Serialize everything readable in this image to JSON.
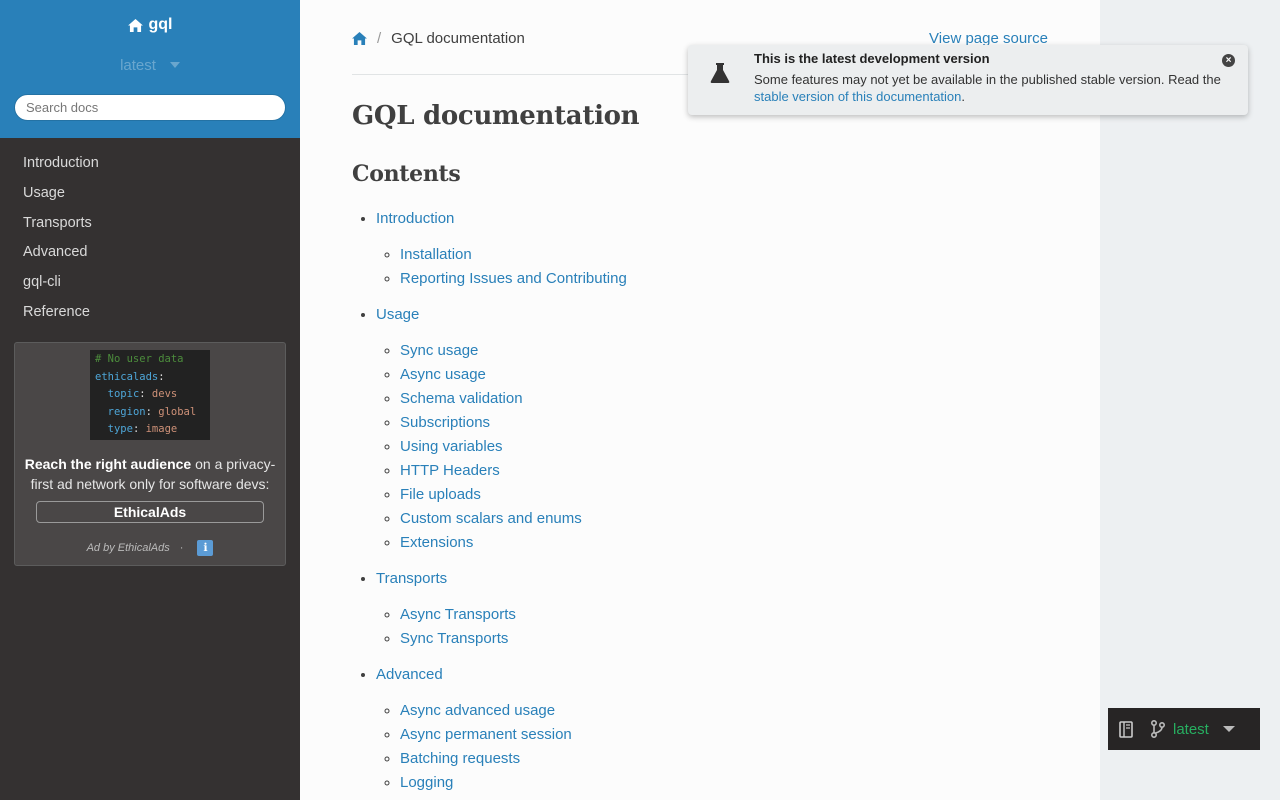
{
  "sidebar": {
    "project_name": "gql",
    "version": "latest",
    "search_placeholder": "Search docs",
    "nav": [
      {
        "label": "Introduction"
      },
      {
        "label": "Usage"
      },
      {
        "label": "Transports"
      },
      {
        "label": "Advanced"
      },
      {
        "label": "gql-cli"
      },
      {
        "label": "Reference"
      }
    ],
    "ad": {
      "code_lines": [
        "# No user data",
        "ethicalads",
        "topic",
        "devs",
        "region",
        "global",
        "type",
        "image"
      ],
      "headline": "Reach the right audience",
      "text": " on a privacy-first ad network only for software devs:",
      "button": "EthicalAds",
      "footer": "Ad by EthicalAds",
      "footer_sep": "·",
      "info_icon": "ℹ"
    }
  },
  "breadcrumb": {
    "home_icon": "home-icon",
    "separator": "/",
    "current": "GQL documentation",
    "view_source": "View page source"
  },
  "page": {
    "title": "GQL documentation",
    "contents_heading": "Contents",
    "toc": [
      {
        "label": "Introduction",
        "children": [
          "Installation",
          "Reporting Issues and Contributing"
        ]
      },
      {
        "label": "Usage",
        "children": [
          "Sync usage",
          "Async usage",
          "Schema validation",
          "Subscriptions",
          "Using variables",
          "HTTP Headers",
          "File uploads",
          "Custom scalars and enums",
          "Extensions"
        ]
      },
      {
        "label": "Transports",
        "children": [
          "Async Transports",
          "Sync Transports"
        ]
      },
      {
        "label": "Advanced",
        "children": [
          "Async advanced usage",
          "Async permanent session",
          "Batching requests",
          "Logging"
        ]
      }
    ]
  },
  "notice": {
    "title": "This is the latest development version",
    "body_prefix": "Some features may not yet be available in the published stable version. Read the ",
    "link": "stable version of this documentation",
    "body_suffix": ".",
    "close": "×"
  },
  "flyout": {
    "version": "latest"
  },
  "colors": {
    "accent": "#2980b9",
    "sidebar_bg": "#343131",
    "flyout_version": "#27ae60"
  }
}
